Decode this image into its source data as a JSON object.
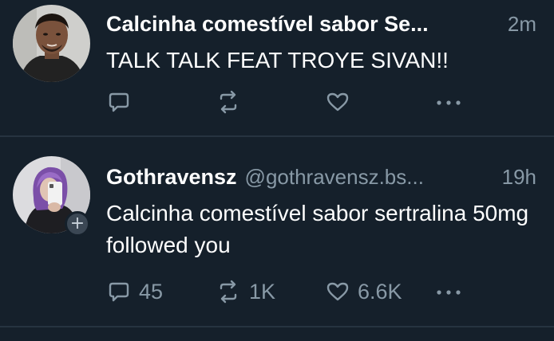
{
  "posts": [
    {
      "name": "Calcinha comestível sabor Se...",
      "handle": "",
      "time": "2m",
      "text": "TALK TALK FEAT TROYE SIVAN!!",
      "has_follow_badge": false,
      "actions": {
        "reply_icon": "reply-icon",
        "reply_count": "",
        "retweet_icon": "retweet-icon",
        "retweet_count": "",
        "like_icon": "heart-icon",
        "like_count": "",
        "more_icon": "more-icon"
      }
    },
    {
      "name": "Gothravensz",
      "handle": "@gothravensz.bs...",
      "time": "19h",
      "text": "Calcinha comestível sabor sertralina 50mg followed you",
      "has_follow_badge": true,
      "follow_badge_icon": "plus-icon",
      "actions": {
        "reply_icon": "reply-icon",
        "reply_count": "45",
        "retweet_icon": "retweet-icon",
        "retweet_count": "1K",
        "like_icon": "heart-icon",
        "like_count": "6.6K",
        "more_icon": "more-icon"
      }
    }
  ],
  "colors": {
    "background": "#15202b",
    "primary_text": "#ffffff",
    "secondary_text": "#8899a6",
    "divider": "#263340"
  }
}
